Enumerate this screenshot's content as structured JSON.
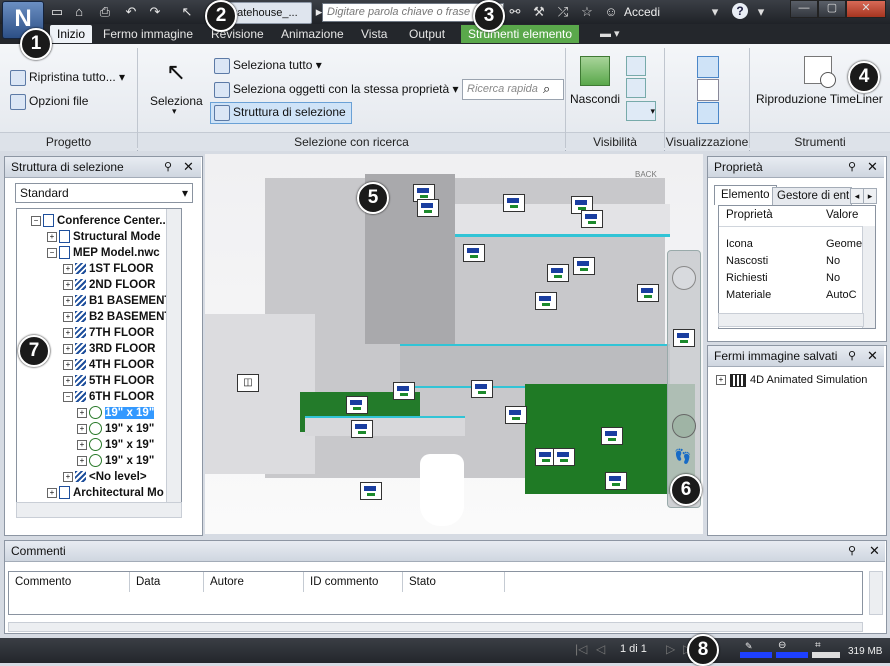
{
  "app": {
    "logo": "N",
    "doc_tab": "gatehouse_...",
    "search_placeholder": "Digitare parola chiave o frase",
    "account": "Accedi",
    "help": "?"
  },
  "tabs": [
    "Inizio",
    "Fermo immagine",
    "Revisione",
    "Animazione",
    "Vista",
    "Output",
    "Strumenti elemento"
  ],
  "ribbon": {
    "progetto": {
      "reset": "Ripristina tutto...",
      "options": "Opzioni file",
      "label": "Progetto"
    },
    "selezione": {
      "select": "Seleziona",
      "select_all": "Seleziona tutto",
      "select_same": "Seleziona oggetti con la stessa proprietà",
      "selection_tree": "Struttura di selezione",
      "quick_search": "Ricerca rapida",
      "label": "Selezione con ricerca"
    },
    "visibilita": {
      "hide": "Nascondi",
      "label": "Visibilità"
    },
    "visualizzazione": {
      "label": "Visualizzazione"
    },
    "strumenti": {
      "timeliner": "Riproduzione TimeLiner",
      "label": "Strumenti"
    }
  },
  "selection_tree": {
    "title": "Struttura di selezione",
    "mode": "Standard",
    "items": [
      {
        "label": "Conference Center..",
        "expander": "−"
      },
      {
        "label": "Structural Mode",
        "expander": "+"
      },
      {
        "label": "MEP Model.nwc",
        "expander": "−"
      },
      {
        "label": "1ST FLOOR",
        "expander": "+"
      },
      {
        "label": "2ND FLOOR",
        "expander": "+"
      },
      {
        "label": "B1 BASEMENT",
        "expander": "+"
      },
      {
        "label": "B2  BASEMENT",
        "expander": "+"
      },
      {
        "label": "7TH FLOOR",
        "expander": "+"
      },
      {
        "label": "3RD FLOOR",
        "expander": "+"
      },
      {
        "label": "4TH FLOOR",
        "expander": "+"
      },
      {
        "label": "5TH FLOOR",
        "expander": "+"
      },
      {
        "label": "6TH FLOOR",
        "expander": "−"
      },
      {
        "label": "19\" x 19\"",
        "expander": "+"
      },
      {
        "label": "19\" x 19\"",
        "expander": "+"
      },
      {
        "label": "19\" x 19\"",
        "expander": "+"
      },
      {
        "label": "19\" x 19\"",
        "expander": "+"
      },
      {
        "label": "<No level>",
        "expander": "+"
      },
      {
        "label": "Architectural Mo",
        "expander": "+"
      }
    ]
  },
  "properties": {
    "title": "Proprietà",
    "tabs": [
      "Elemento",
      "Gestore di ent"
    ],
    "columns": [
      "Proprietà",
      "Valore"
    ],
    "rows": [
      {
        "name": "Icona",
        "value": "Geome"
      },
      {
        "name": "Nascosti",
        "value": "No"
      },
      {
        "name": "Richiesti",
        "value": "No"
      },
      {
        "name": "Materiale",
        "value": "AutoC"
      }
    ]
  },
  "saved_views": {
    "title": "Fermi immagine salvati",
    "items": [
      "4D Animated Simulation"
    ]
  },
  "viewport": {
    "backdrop_label": "BACK"
  },
  "comments": {
    "title": "Commenti",
    "columns": [
      "Commento",
      "Data",
      "Autore",
      "ID commento",
      "Stato"
    ]
  },
  "status": {
    "page": "1 di 1",
    "memory": "319 MB"
  },
  "callouts": [
    "1",
    "2",
    "3",
    "4",
    "5",
    "6",
    "7",
    "8"
  ]
}
